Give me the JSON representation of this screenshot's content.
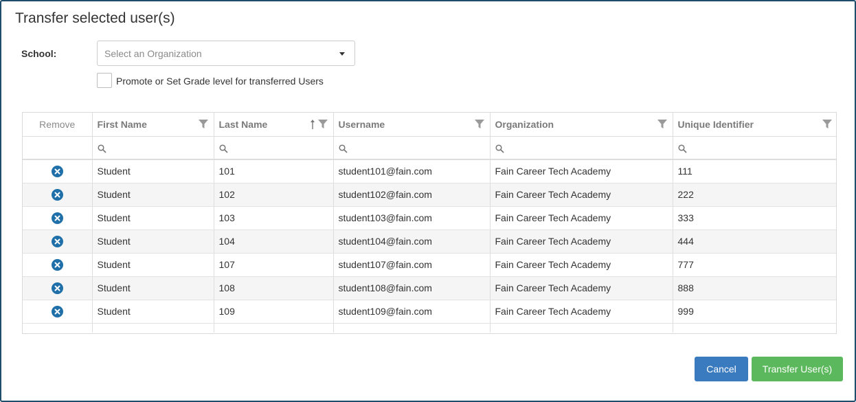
{
  "dialog": {
    "title": "Transfer selected user(s)"
  },
  "school": {
    "label": "School:",
    "placeholder": "Select an Organization"
  },
  "promote": {
    "label": "Promote or Set Grade level for transferred Users",
    "checked": false
  },
  "grid": {
    "columns": [
      "Remove",
      "First Name",
      "Last Name",
      "Username",
      "Organization",
      "Unique Identifier"
    ],
    "sorted_column": "Last Name",
    "sort_direction": "ascending",
    "rows": [
      {
        "first": "Student",
        "last": "101",
        "username": "student101@fain.com",
        "org": "Fain Career Tech Academy",
        "uid": "111"
      },
      {
        "first": "Student",
        "last": "102",
        "username": "student102@fain.com",
        "org": "Fain Career Tech Academy",
        "uid": "222"
      },
      {
        "first": "Student",
        "last": "103",
        "username": "student103@fain.com",
        "org": "Fain Career Tech Academy",
        "uid": "333"
      },
      {
        "first": "Student",
        "last": "104",
        "username": "student104@fain.com",
        "org": "Fain Career Tech Academy",
        "uid": "444"
      },
      {
        "first": "Student",
        "last": "107",
        "username": "student107@fain.com",
        "org": "Fain Career Tech Academy",
        "uid": "777"
      },
      {
        "first": "Student",
        "last": "108",
        "username": "student108@fain.com",
        "org": "Fain Career Tech Academy",
        "uid": "888"
      },
      {
        "first": "Student",
        "last": "109",
        "username": "student109@fain.com",
        "org": "Fain Career Tech Academy",
        "uid": "999"
      }
    ]
  },
  "buttons": {
    "cancel": "Cancel",
    "transfer": "Transfer User(s)"
  },
  "icons": {
    "remove": "remove-circle-icon",
    "filter": "filter-icon",
    "search": "search-icon",
    "sort": "sort-ascending-icon",
    "dropdown": "chevron-down-icon"
  },
  "colors": {
    "remove_icon": "#1f6fa8",
    "cancel_button": "#3a7bbf",
    "transfer_button": "#5cb85c",
    "dialog_border": "#1e4d6b"
  }
}
